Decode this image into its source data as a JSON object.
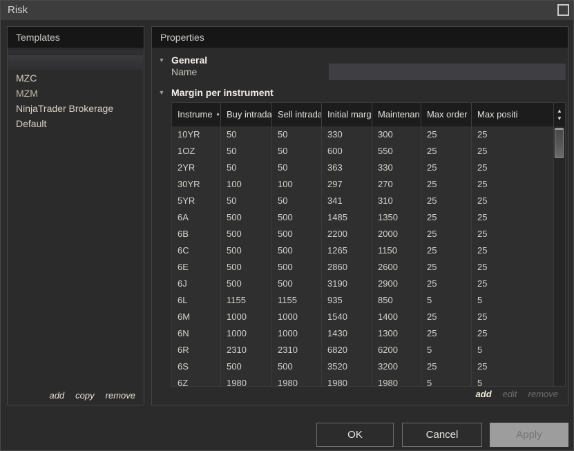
{
  "window": {
    "title": "Risk"
  },
  "templates_panel": {
    "header": "Templates",
    "items": [
      {
        "label": "MZC"
      },
      {
        "label": "MZM"
      },
      {
        "label": "NinjaTrader Brokerage Default"
      }
    ],
    "links": {
      "add": "add",
      "copy": "copy",
      "remove": "remove"
    }
  },
  "properties_panel": {
    "header": "Properties",
    "general_section": {
      "title": "General",
      "name_label": "Name",
      "name_value": ""
    },
    "margin_section": {
      "title": "Margin per instrument"
    },
    "grid": {
      "columns": [
        {
          "label": "Instrume"
        },
        {
          "label": "Buy intrada"
        },
        {
          "label": "Sell intrada"
        },
        {
          "label": "Initial marg"
        },
        {
          "label": "Maintenan"
        },
        {
          "label": "Max order"
        },
        {
          "label": "Max positi"
        }
      ],
      "sort": {
        "column": "Instrument",
        "direction": "ascending",
        "indicator": "▲"
      },
      "rows": [
        {
          "cells": [
            "10YR",
            "50",
            "50",
            "330",
            "300",
            "25",
            "25"
          ]
        },
        {
          "cells": [
            "1OZ",
            "50",
            "50",
            "600",
            "550",
            "25",
            "25"
          ]
        },
        {
          "cells": [
            "2YR",
            "50",
            "50",
            "363",
            "330",
            "25",
            "25"
          ]
        },
        {
          "cells": [
            "30YR",
            "100",
            "100",
            "297",
            "270",
            "25",
            "25"
          ]
        },
        {
          "cells": [
            "5YR",
            "50",
            "50",
            "341",
            "310",
            "25",
            "25"
          ]
        },
        {
          "cells": [
            "6A",
            "500",
            "500",
            "1485",
            "1350",
            "25",
            "25"
          ]
        },
        {
          "cells": [
            "6B",
            "500",
            "500",
            "2200",
            "2000",
            "25",
            "25"
          ]
        },
        {
          "cells": [
            "6C",
            "500",
            "500",
            "1265",
            "1150",
            "25",
            "25"
          ]
        },
        {
          "cells": [
            "6E",
            "500",
            "500",
            "2860",
            "2600",
            "25",
            "25"
          ]
        },
        {
          "cells": [
            "6J",
            "500",
            "500",
            "3190",
            "2900",
            "25",
            "25"
          ]
        },
        {
          "cells": [
            "6L",
            "1155",
            "1155",
            "935",
            "850",
            "5",
            "5"
          ]
        },
        {
          "cells": [
            "6M",
            "1000",
            "1000",
            "1540",
            "1400",
            "25",
            "25"
          ]
        },
        {
          "cells": [
            "6N",
            "1000",
            "1000",
            "1430",
            "1300",
            "25",
            "25"
          ]
        },
        {
          "cells": [
            "6R",
            "2310",
            "2310",
            "6820",
            "6200",
            "5",
            "5"
          ]
        },
        {
          "cells": [
            "6S",
            "500",
            "500",
            "3520",
            "3200",
            "25",
            "25"
          ]
        },
        {
          "cells": [
            "6Z",
            "1980",
            "1980",
            "1980",
            "1980",
            "5",
            "5"
          ]
        }
      ]
    },
    "links": {
      "add": "add",
      "edit": "edit",
      "remove": "remove"
    }
  },
  "footer": {
    "ok": "OK",
    "cancel": "Cancel",
    "apply": "Apply"
  },
  "icons": {
    "maximize": "maximize-icon",
    "sort_asc": "sort-ascending-icon",
    "scroll_up": "▲",
    "scroll_down": "▼",
    "collapse": "▼"
  },
  "colors": {
    "window_bg": "#2b2b2b",
    "titlebar_bg": "#3d3d3d",
    "panel_header_bg": "#161616",
    "grid_header_bg": "#1c1c1c",
    "grid_row_bg": "#2f2f30",
    "input_bg": "#3e3e43",
    "apply_disabled_bg": "#9d9d9d",
    "disabled_text": "#6e6e6e",
    "row_text": "#d6d2ca"
  }
}
